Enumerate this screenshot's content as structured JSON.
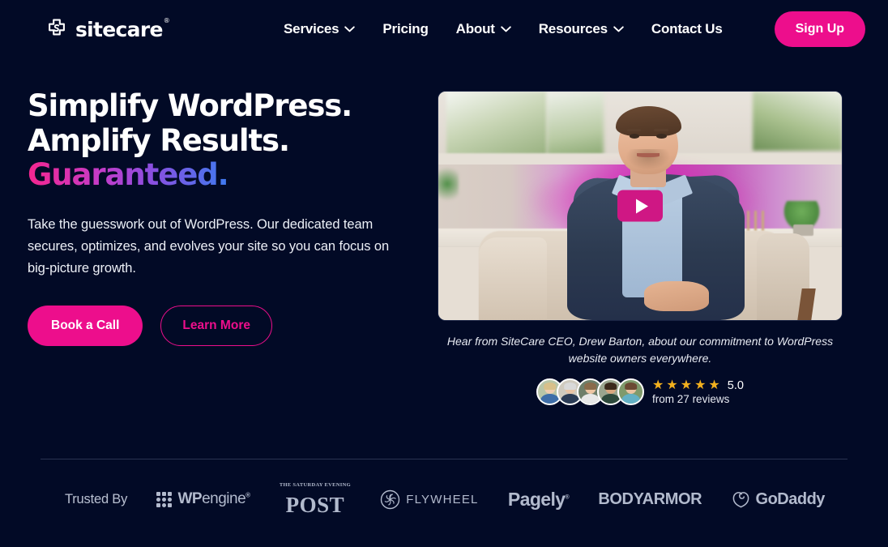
{
  "header": {
    "logo": {
      "name": "sitecare",
      "mark": "sitecare-cross-icon",
      "registered": "®"
    },
    "nav": [
      {
        "label": "Services",
        "caret": true
      },
      {
        "label": "Pricing",
        "caret": false
      },
      {
        "label": "About",
        "caret": true
      },
      {
        "label": "Resources",
        "caret": true
      },
      {
        "label": "Contact Us",
        "caret": false
      }
    ],
    "signup_label": "Sign Up"
  },
  "hero": {
    "headline_line1": "Simplify WordPress.",
    "headline_line2": "Amplify Results.",
    "headline_line3": "Guaranteed.",
    "paragraph": "Take the guesswork out of WordPress. Our dedicated team secures, optimizes, and evolves your site so you can focus on big-picture growth.",
    "primary_cta": "Book a Call",
    "secondary_cta": "Learn More"
  },
  "video": {
    "play_label": "play-button",
    "caption": "Hear from SiteCare CEO, Drew Barton, about our commitment to WordPress website owners everywhere."
  },
  "reviews": {
    "stars": [
      "★",
      "★",
      "★",
      "★",
      "★"
    ],
    "rating": "5.0",
    "count_text": "from 27 reviews",
    "avatars": [
      {
        "alt": "reviewer-1",
        "skin": "#f0cdb0",
        "hair": "#d8c08a",
        "shirt": "#3f6ea8",
        "bg": "#b9c6a8"
      },
      {
        "alt": "reviewer-2",
        "skin": "#e8c4a6",
        "hair": "#d9d9d9",
        "shirt": "#2b3c56",
        "bg": "#cfcabe"
      },
      {
        "alt": "reviewer-3",
        "skin": "#eec6a4",
        "hair": "#8a6b4b",
        "shirt": "#e8e8e8",
        "bg": "#6f7f6a"
      },
      {
        "alt": "reviewer-4",
        "skin": "#d8a77f",
        "hair": "#3b2a1c",
        "shirt": "#2e4a3c",
        "bg": "#9aa58e"
      },
      {
        "alt": "reviewer-5",
        "skin": "#eac3a2",
        "hair": "#6b4a33",
        "shirt": "#63b0c4",
        "bg": "#7f9a6c"
      }
    ]
  },
  "trusted": {
    "label": "Trusted By",
    "brands": [
      {
        "id": "wpengine",
        "name_bold": "WP",
        "name_thin": "engine",
        "registered": "®"
      },
      {
        "id": "saturday-evening-post",
        "top": "THE SATURDAY EVENING",
        "main": "POST"
      },
      {
        "id": "flywheel",
        "name": "FLYWHEEL"
      },
      {
        "id": "pagely",
        "name": "Pagely",
        "registered": "®"
      },
      {
        "id": "bodyarmor",
        "name": "BODYARMOR"
      },
      {
        "id": "godaddy",
        "name": "GoDaddy"
      }
    ]
  },
  "colors": {
    "background": "#020A26",
    "accent_pink": "#ED0E8C",
    "star_gold": "#F2B01E",
    "gradient_start": "#F5268F",
    "gradient_end": "#3E7BF0"
  }
}
